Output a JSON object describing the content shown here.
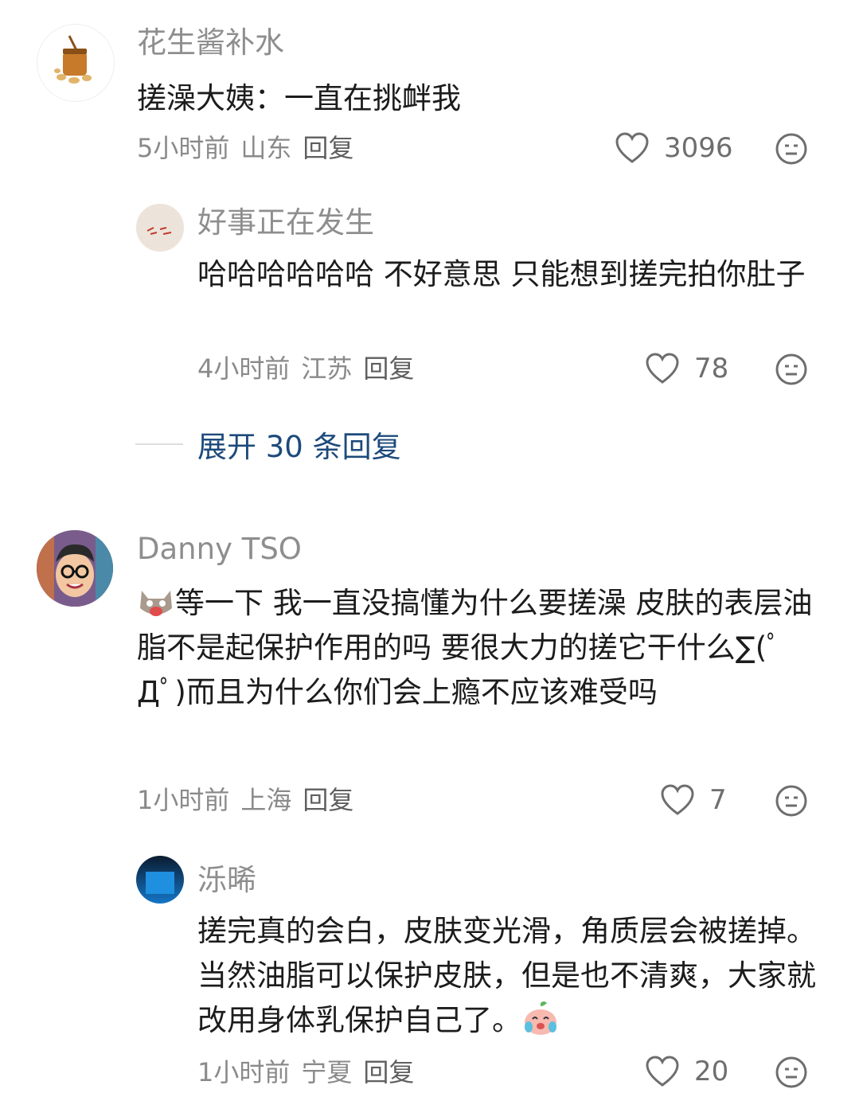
{
  "comments": [
    {
      "user": "花生酱补水",
      "text": "搓澡大姨：一直在挑衅我",
      "time": "5小时前",
      "location": "山东",
      "reply_label": "回复",
      "likes": "3096",
      "avatar_icon": "peanut-butter-jar-icon",
      "replies": [
        {
          "user": "好事正在发生",
          "text": "哈哈哈哈哈哈 不好意思 只能想到搓完拍你肚子",
          "time": "4小时前",
          "location": "江苏",
          "reply_label": "回复",
          "likes": "78",
          "avatar_icon": "handwritten-sign-avatar"
        }
      ],
      "expand_label": "展开 30 条回复"
    },
    {
      "user": "Danny TSO",
      "text": "等一下 我一直没搞懂为什么要搓澡 皮肤的表层油脂不是起保护作用的吗 要很大力的搓它干什么∑(ﾟДﾟ)而且为什么你们会上瘾不应该难受吗",
      "time": "1小时前",
      "location": "上海",
      "reply_label": "回复",
      "likes": "7",
      "avatar_icon": "cartoon-man-glasses-avatar",
      "leading_emoji": "shocked-cat-emoji",
      "replies": [
        {
          "user": "泺晞",
          "text": "搓完真的会白，皮肤变光滑，角质层会被搓掉。当然油脂可以保护皮肤，但是也不清爽，大家就改用身体乳保护自己了。",
          "time": "1小时前",
          "location": "宁夏",
          "reply_label": "回复",
          "likes": "20",
          "avatar_icon": "blue-gradient-avatar",
          "trailing_emoji": "crying-peach-emoji"
        }
      ]
    }
  ],
  "colors": {
    "username": "#8e8e8e",
    "text": "#1c1c1c",
    "meta": "#8a8a8a",
    "expand_link": "#1d4a7c"
  }
}
